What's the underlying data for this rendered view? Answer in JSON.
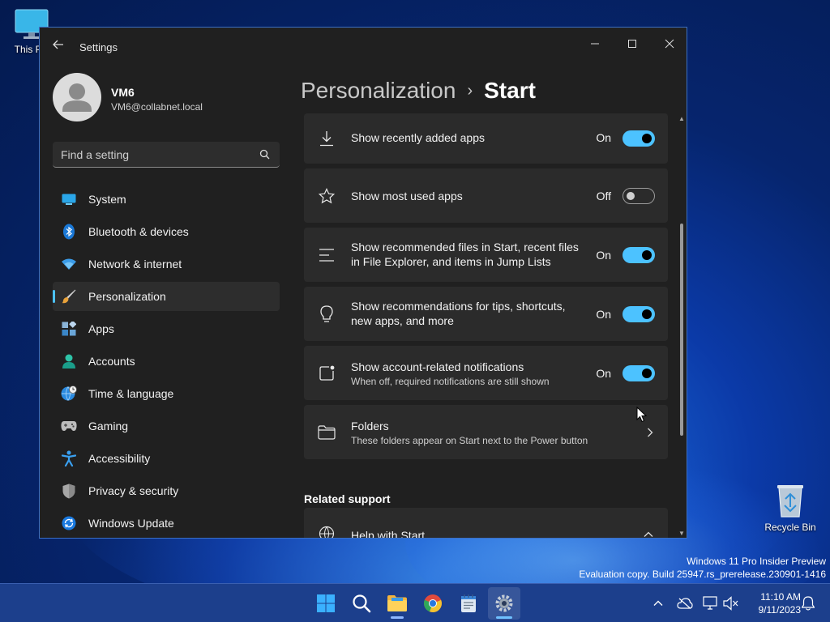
{
  "desktop": {
    "icons": [
      {
        "label": "This PC"
      },
      {
        "label": "Recycle Bin"
      }
    ],
    "watermark": {
      "line1": "Windows 11 Pro Insider Preview",
      "line2": "Evaluation copy. Build 25947.rs_prerelease.230901-1416"
    }
  },
  "window": {
    "title": "Settings",
    "controls": {
      "minimize": "—",
      "maximize": "☐",
      "close": "✕"
    },
    "profile": {
      "name": "VM6",
      "email": "VM6@collabnet.local"
    },
    "search": {
      "placeholder": "Find a setting"
    },
    "nav": [
      {
        "label": "System",
        "icon": "system-icon"
      },
      {
        "label": "Bluetooth & devices",
        "icon": "bluetooth-icon"
      },
      {
        "label": "Network & internet",
        "icon": "wifi-icon"
      },
      {
        "label": "Personalization",
        "icon": "brush-icon",
        "active": true
      },
      {
        "label": "Apps",
        "icon": "apps-icon"
      },
      {
        "label": "Accounts",
        "icon": "accounts-icon"
      },
      {
        "label": "Time & language",
        "icon": "globe-clock-icon"
      },
      {
        "label": "Gaming",
        "icon": "gamepad-icon"
      },
      {
        "label": "Accessibility",
        "icon": "accessibility-icon"
      },
      {
        "label": "Privacy & security",
        "icon": "shield-icon"
      },
      {
        "label": "Windows Update",
        "icon": "update-icon"
      }
    ],
    "breadcrumb": {
      "parent": "Personalization",
      "separator": "›",
      "current": "Start"
    },
    "settings": [
      {
        "title": "Show recently added apps",
        "state": "On",
        "on": true,
        "icon": "download-icon"
      },
      {
        "title": "Show most used apps",
        "state": "Off",
        "on": false,
        "icon": "star-icon"
      },
      {
        "title": "Show recommended files in Start, recent files in File Explorer, and items in Jump Lists",
        "state": "On",
        "on": true,
        "icon": "list-icon"
      },
      {
        "title": "Show recommendations for tips, shortcuts, new apps, and more",
        "state": "On",
        "on": true,
        "icon": "lightbulb-icon"
      },
      {
        "title": "Show account-related notifications",
        "subtitle": "When off, required notifications are still shown",
        "state": "On",
        "on": true,
        "icon": "notification-icon"
      },
      {
        "title": "Folders",
        "subtitle": "These folders appear on Start next to the Power button",
        "icon": "folder-icon"
      }
    ],
    "related_support": {
      "heading": "Related support",
      "items": [
        {
          "title": "Help with Start",
          "icon": "globe-icon"
        }
      ]
    }
  },
  "taskbar": {
    "apps": [
      "start-icon",
      "search-icon",
      "file-explorer-icon",
      "chrome-icon",
      "notepad-icon",
      "settings-icon"
    ],
    "clock": {
      "time": "11:10 AM",
      "date": "9/11/2023"
    }
  },
  "colors": {
    "accent": "#4cc2ff",
    "window_bg": "#202020",
    "card_bg": "#2b2b2b"
  }
}
